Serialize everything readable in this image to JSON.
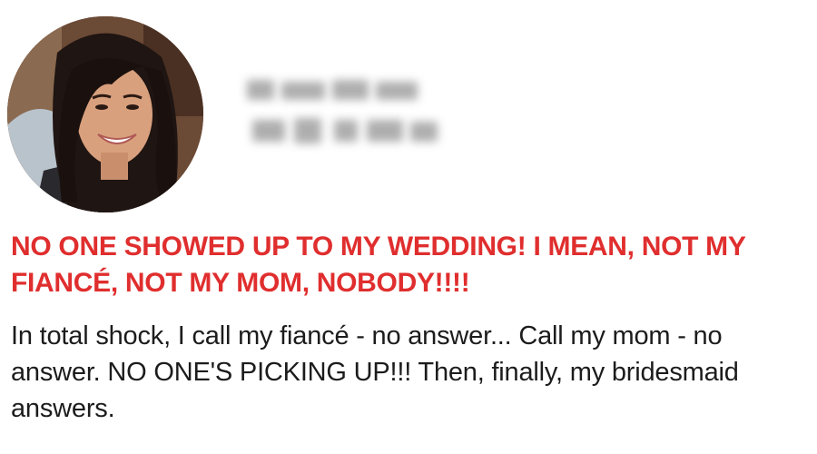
{
  "post": {
    "headline": "NO ONE SHOWED UP TO MY WEDDING! I MEAN, NOT MY FIANCÉ, NOT MY MOM, NOBODY!!!!",
    "body": "In total shock, I call my fiancé - no answer... Call my mom - no answer. NO ONE'S PICKING UP!!! Then, finally, my bridesmaid answers."
  },
  "colors": {
    "headline": "#e02e2e",
    "body_text": "#1c1c1c",
    "background": "#ffffff"
  }
}
